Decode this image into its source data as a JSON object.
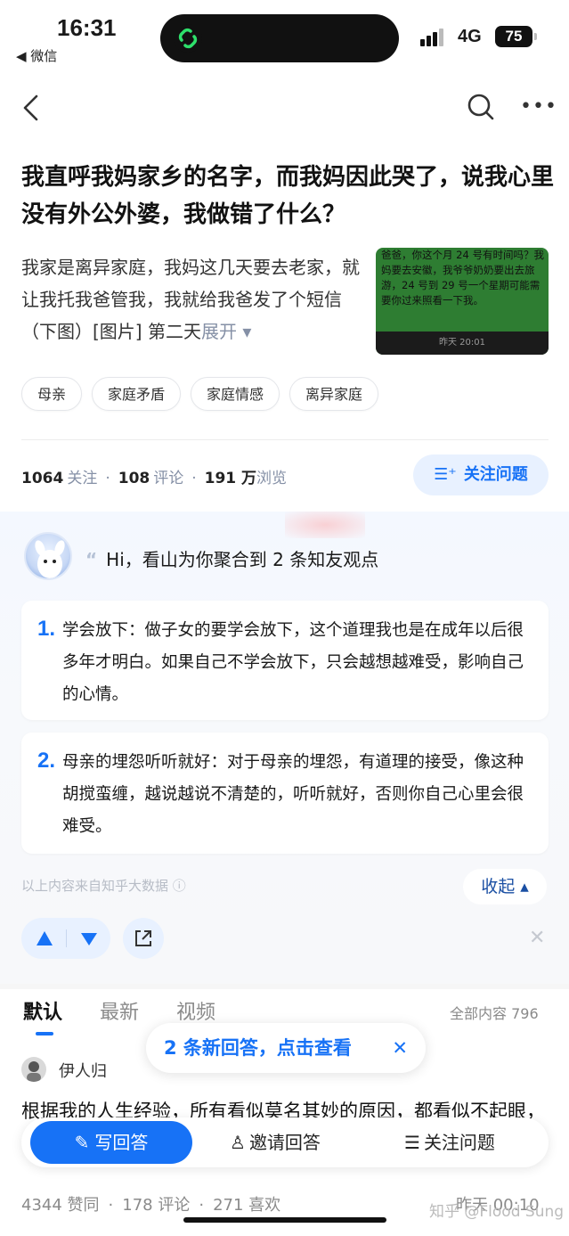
{
  "status": {
    "time": "16:31",
    "back_app": "◀ 微信",
    "network": "4G",
    "battery": "75"
  },
  "question": {
    "title": "我直呼我妈家乡的名字，而我妈因此哭了，说我心里没有外公外婆，我做错了什么？",
    "excerpt": "我家是离异家庭，我妈这几天要去老家，就让我托我爸管我，我就给我爸发了个短信（下图）[图片] 第二天",
    "expand_label": "展开 ▾",
    "thumb_text": "爸爸，你这个月 24 号有时间吗？我妈要去安徽，我爷爷奶奶要出去旅游，24 号到 29 号一个星期可能需要你过来照看一下我。",
    "thumb_time": "昨天 20:01",
    "tags": [
      "母亲",
      "家庭矛盾",
      "家庭情感",
      "离异家庭"
    ],
    "stats": {
      "follows": "1064",
      "follows_label": "关注",
      "comments": "108",
      "comments_label": "评论",
      "views": "191 万",
      "views_label": "浏览"
    },
    "follow_button": "关注问题"
  },
  "ai_summary": {
    "greeting": "Hi，看山为你聚合到 2 条知友观点",
    "points": [
      {
        "num": "1.",
        "text": "学会放下：做子女的要学会放下，这个道理我也是在成年以后很多年才明白。如果自己不学会放下，只会越想越难受，影响自己的心情。"
      },
      {
        "num": "2.",
        "text": "母亲的埋怨听听就好：对于母亲的埋怨，有道理的接受，像这种胡搅蛮缠，越说越说不清楚的，听听就好，否则你自己心里会很难受。"
      }
    ],
    "source": "以上内容来自知乎大数据 ⓘ",
    "collapse": "收起 ▴"
  },
  "answers": {
    "tabs": [
      "默认",
      "最新",
      "视频"
    ],
    "all_content": "全部内容 796",
    "new_answers_toast": "2 条新回答，点击查看",
    "toast_close": "✕",
    "first": {
      "author": "伊人归",
      "text": "根据我的人生经验，所有看似莫名其妙的原因，都看似不起眼，导致了最大的矛盾，因为怨根早",
      "likes": "4344 赞同",
      "comments": "178 评论",
      "favs": "271 喜欢",
      "time": "昨天 00:10"
    }
  },
  "bottom_bar": {
    "write": "写回答",
    "invite": "邀请回答",
    "follow": "关注问题"
  },
  "watermark": "知乎 @Flood Sung",
  "colors": {
    "accent": "#1772f6",
    "tag_border": "#e4e6ea",
    "ai_bg": "#f4f8ff"
  }
}
